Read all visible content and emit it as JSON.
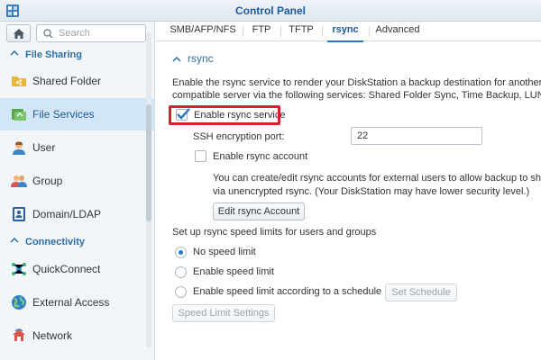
{
  "window": {
    "title": "Control Panel"
  },
  "sidebar": {
    "search_placeholder": "Search",
    "sections": [
      {
        "label": "File Sharing"
      },
      {
        "label": "Connectivity"
      }
    ],
    "items": [
      {
        "label": "Shared Folder",
        "icon": "folder-share-icon"
      },
      {
        "label": "File Services",
        "icon": "file-services-icon",
        "active": true
      },
      {
        "label": "User",
        "icon": "user-icon"
      },
      {
        "label": "Group",
        "icon": "group-icon"
      },
      {
        "label": "Domain/LDAP",
        "icon": "domain-ldap-icon"
      },
      {
        "label": "QuickConnect",
        "icon": "quickconnect-icon"
      },
      {
        "label": "External Access",
        "icon": "globe-icon"
      },
      {
        "label": "Network",
        "icon": "network-icon"
      }
    ]
  },
  "tabs": [
    {
      "label": "SMB/AFP/NFS"
    },
    {
      "label": "FTP"
    },
    {
      "label": "TFTP"
    },
    {
      "label": "rsync",
      "active": true
    },
    {
      "label": "Advanced"
    }
  ],
  "rsync": {
    "section_title": "rsync",
    "description_line1": "Enable the rsync service to render your DiskStation a backup destination for another Synology",
    "description_line2": "compatible server via the following services: Shared Folder Sync, Time Backup, LUN Backup, e",
    "enable_service_label": "Enable rsync service",
    "enable_service_checked": true,
    "ssh_port_label": "SSH encryption port:",
    "ssh_port_value": "22",
    "enable_account_label": "Enable rsync account",
    "enable_account_checked": false,
    "account_note_line1": "You can create/edit rsync accounts for external users to allow backup to shared fol",
    "account_note_line2": "via unencrypted rsync. (Your DiskStation may have lower security level.)",
    "edit_account_button": "Edit rsync Account",
    "speed_limit_heading": "Set up rsync speed limits for users and groups",
    "speed_options": [
      {
        "label": "No speed limit",
        "selected": true
      },
      {
        "label": "Enable speed limit",
        "selected": false
      },
      {
        "label": "Enable speed limit according to a schedule",
        "selected": false
      }
    ],
    "set_schedule_button": "Set Schedule",
    "speed_settings_button": "Speed Limit Settings"
  },
  "colors": {
    "accent": "#2a78c4",
    "title": "#1a5a9c",
    "highlight": "#d8202a",
    "active_bg": "#d2e6f8"
  }
}
